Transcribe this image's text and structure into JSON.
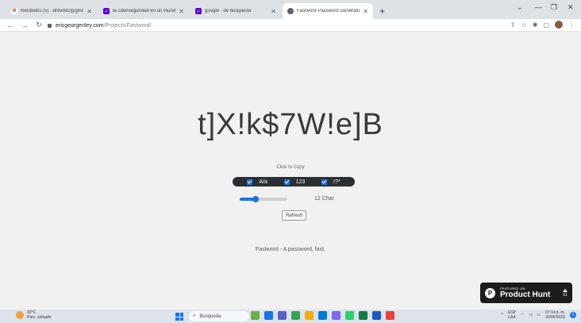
{
  "browser": {
    "tabs": [
      {
        "title": "Recibidos (5) - drdvd82@gmail.c",
        "icon": "gmail-icon",
        "color": "#ea4335",
        "active": false
      },
      {
        "title": "la ciberseguridad en un mundo p",
        "icon": "yahoo-icon",
        "color": "#6001d2",
        "active": false
      },
      {
        "title": "google - de búsqueda",
        "icon": "yahoo-icon",
        "color": "#6001d2",
        "active": false
      },
      {
        "title": "Fastword Password Generator | A",
        "icon": "globe-icon",
        "color": "#5f6368",
        "active": true
      }
    ],
    "new_tab": "+",
    "url_host": "ericgeorgeriley.com",
    "url_path": "/Projects/Fastword/"
  },
  "page": {
    "password": "t]X!k$7W!e]B",
    "copy_hint": "Click to Copy",
    "options": [
      {
        "label": "A/a",
        "checked": true
      },
      {
        "label": "123",
        "checked": true
      },
      {
        "label": "!?*",
        "checked": true
      }
    ],
    "length_label": "12 Char",
    "length_fraction": 0.33,
    "refresh_label": "Refresh",
    "tagline": "Fastword - A password, fast."
  },
  "product_hunt": {
    "featured": "FEATURED ON",
    "name": "Product Hunt",
    "votes": "51"
  },
  "taskbar": {
    "temp": "32°C",
    "condition": "Parc. soleado",
    "search_placeholder": "Búsqueda",
    "lang_top": "ESP",
    "lang_bottom": "LAA",
    "time": "07:14 p. m.",
    "date": "20/06/2023",
    "notification_count": "1",
    "app_colors": [
      "#6ab04c",
      "#1a73e8",
      "#5b5fc7",
      "#34a853",
      "#f9ab00",
      "#0078d4",
      "#7b68ee",
      "#25d366",
      "#107c41",
      "#185abd",
      "#ea4335"
    ]
  }
}
